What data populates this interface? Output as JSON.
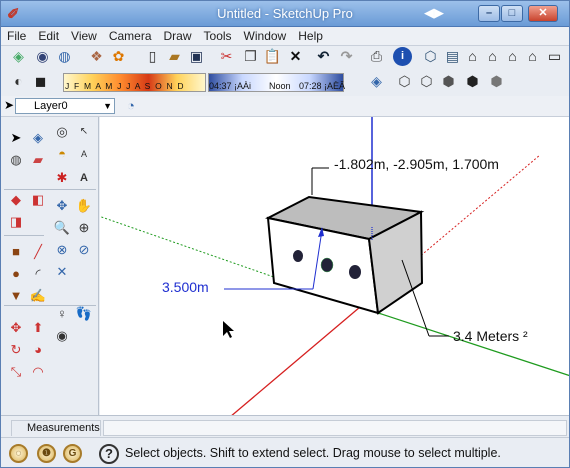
{
  "window": {
    "title": "Untitled - SketchUp Pro",
    "nav_glyph": "◀▶",
    "minimize": "–",
    "maximize": "□",
    "close": "✕"
  },
  "menu": [
    "File",
    "Edit",
    "View",
    "Camera",
    "Draw",
    "Tools",
    "Window",
    "Help"
  ],
  "shadow_bar": {
    "months": "J F M A M J J A S O N D",
    "time_start": "04:37",
    "time_start_suffix": "¡AÀi",
    "noon": "Noon",
    "time_end": "07:28 ¡AÈÂ"
  },
  "layer": {
    "selected": "Layer0"
  },
  "viewport": {
    "dimension_label": "3.500m",
    "coordinate_label": "-1.802m, -2.905m, 1.700m",
    "area_label": "3.4 Meters ²"
  },
  "measurements": {
    "label": "Measurements",
    "value": ""
  },
  "status": {
    "text": "Select objects. Shift to extend select. Drag mouse to select multiple."
  },
  "colors": {
    "titlebar": "#7aa6dd",
    "axis_red": "#d62020",
    "axis_green": "#1f9b1f",
    "axis_blue": "#1f2fd0",
    "box_top": "#bdbdbd",
    "box_side": "#d0d0d0"
  }
}
